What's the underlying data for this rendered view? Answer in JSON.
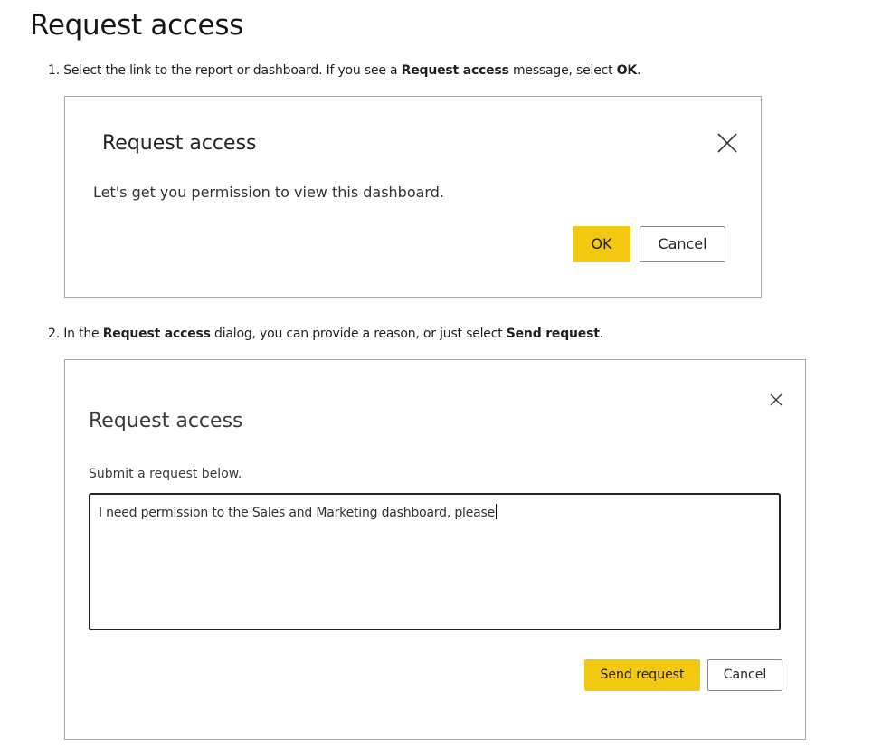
{
  "page": {
    "title": "Request access"
  },
  "step1": {
    "number": "1.",
    "text_before": " Select the link to the report or dashboard. If you see a ",
    "bold1": "Request access",
    "text_middle": " message, select ",
    "bold2": "OK",
    "text_after": "."
  },
  "dialog1": {
    "title": "Request access",
    "close_icon": "close-icon",
    "message": "Let's get you permission to view this dashboard.",
    "ok_label": "OK",
    "cancel_label": "Cancel"
  },
  "step2": {
    "number": "2.",
    "text_before": " In the ",
    "bold1": "Request access",
    "text_middle": " dialog, you can provide a reason, or just select ",
    "bold2": "Send request",
    "text_after": "."
  },
  "dialog2": {
    "title": "Request access",
    "close_icon": "close-icon",
    "label": "Submit a request below.",
    "request_text": "I need permission to the Sales and Marketing dashboard, please",
    "send_label": "Send request",
    "cancel_label": "Cancel"
  },
  "colors": {
    "accent_yellow": "#F2C811",
    "border_gray": "#A8A8A8",
    "text_dark": "#252423"
  }
}
